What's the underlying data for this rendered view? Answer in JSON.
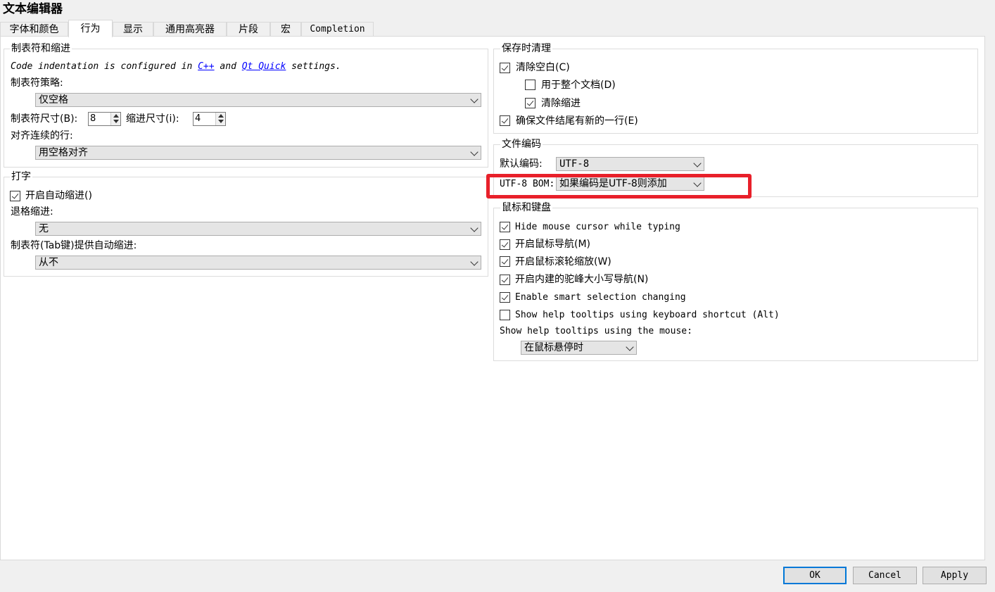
{
  "window": {
    "title": "文本编辑器"
  },
  "tabs": [
    "字体和颜色",
    "行为",
    "显示",
    "通用高亮器",
    "片段",
    "宏",
    "Completion"
  ],
  "tabs_active": "行为",
  "tabs_indent": {
    "title": "制表符和缩进",
    "hint_prefix": "Code indentation is configured in ",
    "hint_link1": "C++",
    "hint_and": " and ",
    "hint_link2": "Qt Quick",
    "hint_suffix": " settings.",
    "policy_label": "制表符策略:",
    "policy_value": "仅空格",
    "tab_size_label": "制表符尺寸(B):",
    "tab_size_value": "8",
    "indent_size_label": "缩进尺寸(i):",
    "indent_size_value": "4",
    "align_label": "对齐连续的行:",
    "align_value": "用空格对齐"
  },
  "typing": {
    "title": "打字",
    "auto_indent_label": "开启自动缩进()",
    "auto_indent_checked": true,
    "backspace_label": "退格缩进:",
    "backspace_value": "无",
    "tab_key_label": "制表符(Tab键)提供自动缩进:",
    "tab_key_value": "从不"
  },
  "cleanup": {
    "title": "保存时清理",
    "items": [
      {
        "label": "清除空白(C)",
        "checked": true
      },
      {
        "label": "用于整个文档(D)",
        "checked": false
      },
      {
        "label": "清除缩进",
        "checked": true
      },
      {
        "label": "确保文件结尾有新的一行(E)",
        "checked": true
      }
    ]
  },
  "encoding": {
    "title": "文件编码",
    "default_label": "默认编码:",
    "default_value": "UTF-8",
    "bom_label": "UTF-8 BOM:",
    "bom_value": "如果编码是UTF-8则添加",
    "highlight_color": "#e8202a"
  },
  "mouse": {
    "title": "鼠标和键盘",
    "items": [
      {
        "label": "Hide mouse cursor while typing",
        "checked": true
      },
      {
        "label": "开启鼠标导航(M)",
        "checked": true
      },
      {
        "label": "开启鼠标滚轮缩放(W)",
        "checked": true
      },
      {
        "label": "开启内建的驼峰大小写导航(N)",
        "checked": true
      },
      {
        "label": "Enable smart selection changing",
        "checked": true
      },
      {
        "label": "Show help tooltips using keyboard shortcut (Alt)",
        "checked": false
      }
    ],
    "tooltip_mouse_label": "Show help tooltips using the mouse:",
    "tooltip_mouse_value": "在鼠标悬停时"
  },
  "buttons": {
    "ok": "OK",
    "cancel": "Cancel",
    "apply": "Apply"
  },
  "colors": {
    "accent": "#0078d7",
    "link": "#0000ff"
  }
}
